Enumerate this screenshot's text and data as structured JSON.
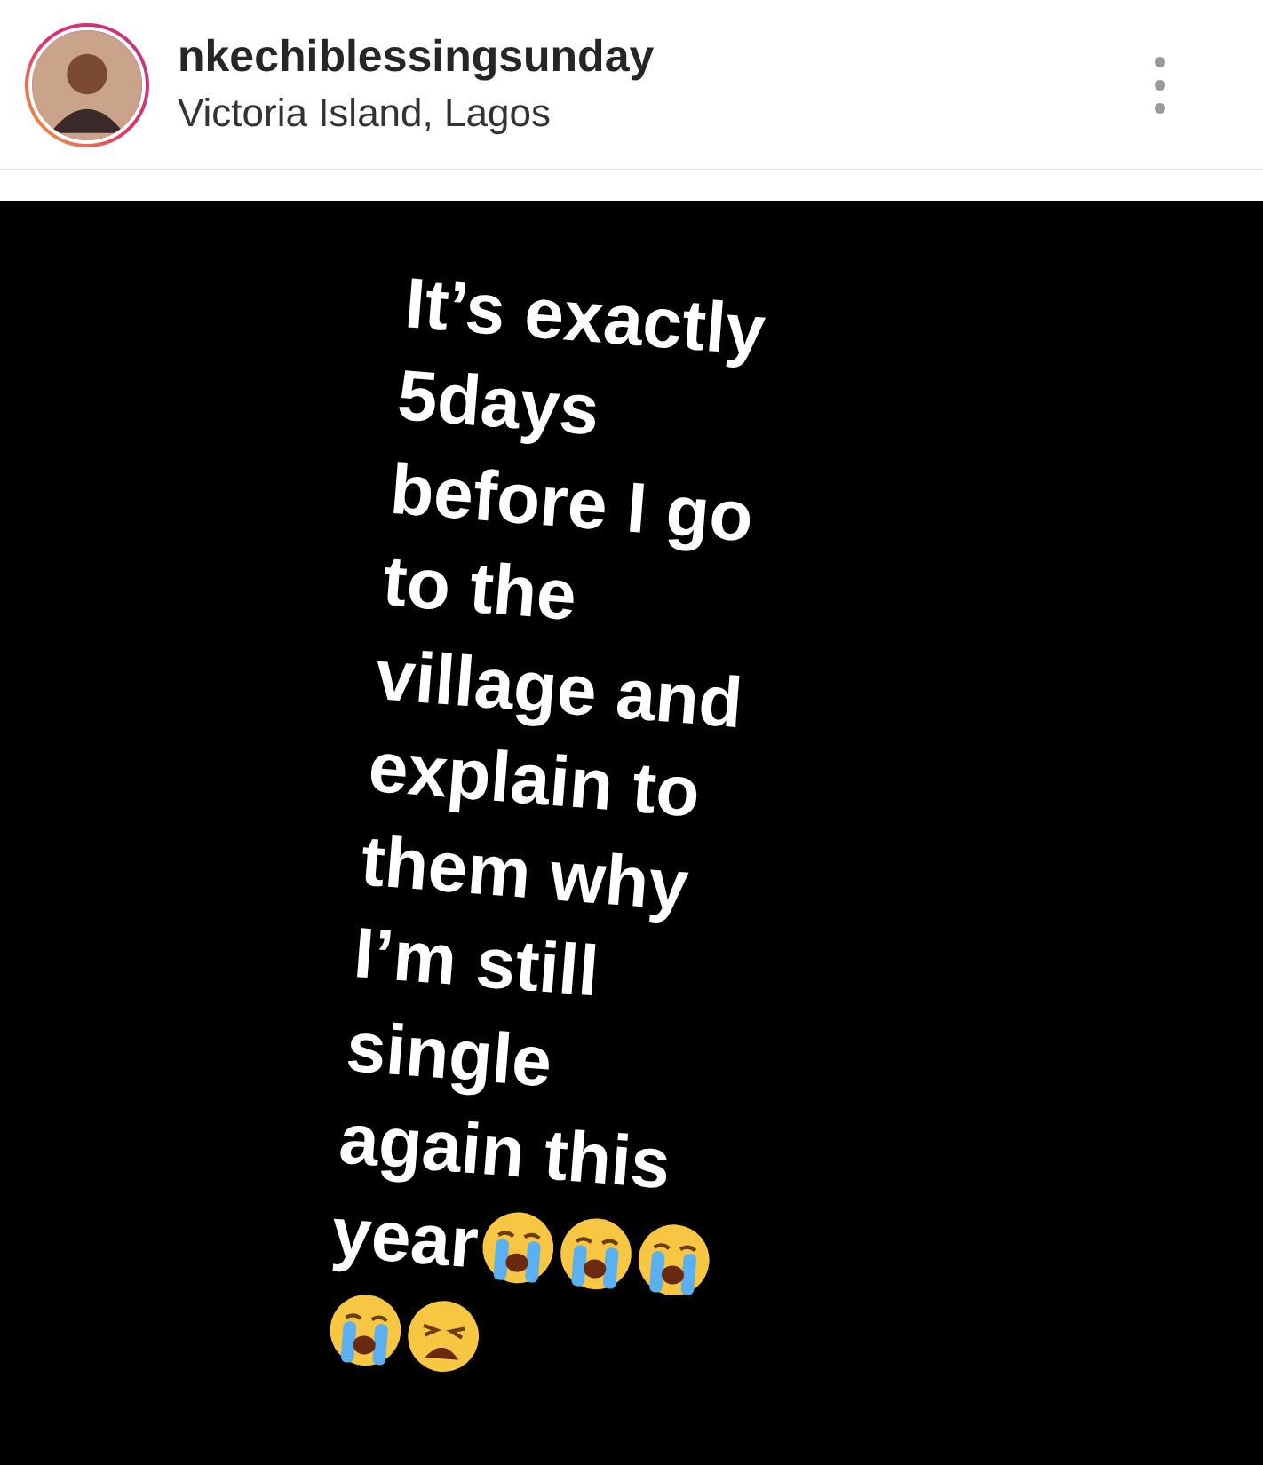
{
  "post": {
    "username": "nkechiblessingsunday",
    "location": "Victoria Island, Lagos"
  },
  "image_lines": [
    {
      "text": "It’s exactly"
    },
    {
      "text": "5days"
    },
    {
      "text": "before I go"
    },
    {
      "text": "to the"
    },
    {
      "text": "village and"
    },
    {
      "text": "explain to"
    },
    {
      "text": "them why"
    },
    {
      "text": "I’m still"
    },
    {
      "text": "single"
    },
    {
      "text": "again this"
    },
    {
      "text": "year",
      "emojis": [
        {
          "kind": "crying"
        },
        {
          "kind": "crying"
        },
        {
          "kind": "crying"
        }
      ]
    },
    {
      "emojis": [
        {
          "kind": "crying"
        },
        {
          "kind": "weary"
        }
      ]
    }
  ]
}
